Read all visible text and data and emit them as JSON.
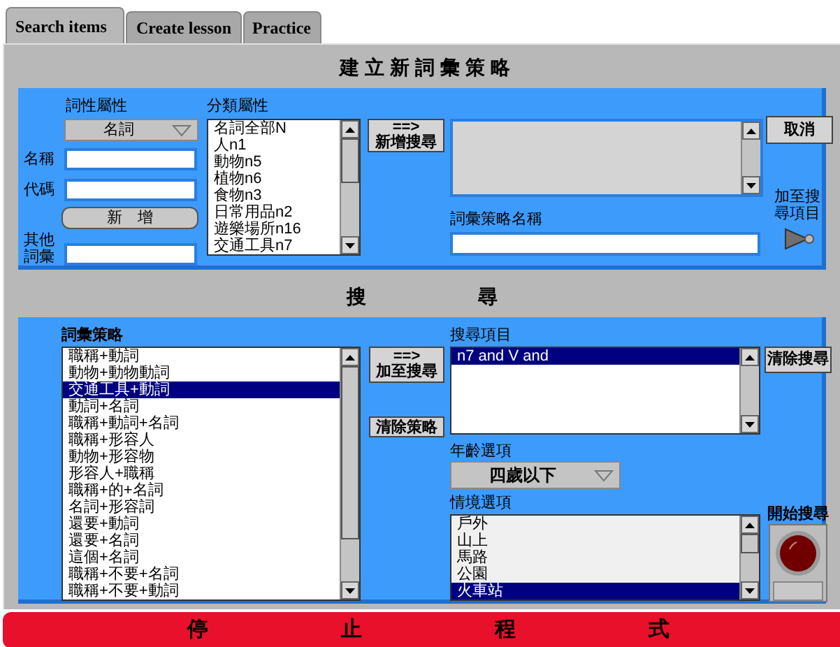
{
  "tabs": [
    {
      "label": "Search items",
      "selected": true
    },
    {
      "label": "Create lesson",
      "selected": false
    },
    {
      "label": "Practice",
      "selected": false
    }
  ],
  "title": "建立新詞彙策略",
  "create": {
    "pos_label": "詞性屬性",
    "pos_dropdown": "名詞",
    "fields": [
      {
        "label": "名稱"
      },
      {
        "label": "代碼"
      }
    ],
    "add_button": "新　增",
    "other_label": "其他詞彙",
    "category_label": "分類屬性",
    "categories": [
      {
        "text": "名詞全部N",
        "selected": false
      },
      {
        "text": "人n1",
        "selected": false
      },
      {
        "text": "動物n5",
        "selected": false
      },
      {
        "text": "植物n6",
        "selected": false
      },
      {
        "text": "食物n3",
        "selected": false
      },
      {
        "text": "日常用品n2",
        "selected": false
      },
      {
        "text": "遊樂場所n16",
        "selected": false
      },
      {
        "text": "交通工具n7",
        "selected": false
      }
    ],
    "add_search_button": {
      "arrow": "==>",
      "label": "新增搜尋"
    },
    "cancel_button": "取消",
    "strategy_name_label": "詞彙策略名稱",
    "add_to_search_label": "加至搜尋項目"
  },
  "search_heading": [
    "搜",
    "尋"
  ],
  "search": {
    "strategies_label": "詞彙策略",
    "strategies": [
      {
        "text": "職稱+動詞",
        "selected": false
      },
      {
        "text": "動物+動物動詞",
        "selected": false
      },
      {
        "text": "交通工具+動詞",
        "selected": true
      },
      {
        "text": "動詞+名詞",
        "selected": false
      },
      {
        "text": "職稱+動詞+名詞",
        "selected": false
      },
      {
        "text": "職稱+形容人",
        "selected": false
      },
      {
        "text": "動物+形容物",
        "selected": false
      },
      {
        "text": "形容人+職稱",
        "selected": false
      },
      {
        "text": "職稱+的+名詞",
        "selected": false
      },
      {
        "text": "名詞+形容詞",
        "selected": false
      },
      {
        "text": "還要+動詞",
        "selected": false
      },
      {
        "text": "還要+名詞",
        "selected": false
      },
      {
        "text": "這個+名詞",
        "selected": false
      },
      {
        "text": "職稱+不要+名詞",
        "selected": false
      },
      {
        "text": "職稱+不要+動詞",
        "selected": false
      }
    ],
    "add_to_search_button": {
      "arrow": "==>",
      "label": "加至搜尋"
    },
    "clear_strategy_button": "清除策略",
    "search_items_label": "搜尋項目",
    "search_items": [
      {
        "text": "n7 and V and",
        "selected": true
      }
    ],
    "clear_search_button": "清除搜尋",
    "age_label": "年齡選項",
    "age_dropdown": "四歲以下",
    "context_label": "情境選項",
    "contexts": [
      {
        "text": "戶外",
        "selected": false
      },
      {
        "text": "山上",
        "selected": false
      },
      {
        "text": "馬路",
        "selected": false
      },
      {
        "text": "公園",
        "selected": false
      },
      {
        "text": "火車站",
        "selected": true
      }
    ],
    "start_label": "開始搜尋"
  },
  "stop_button": [
    "停",
    "止",
    "程",
    "式"
  ]
}
